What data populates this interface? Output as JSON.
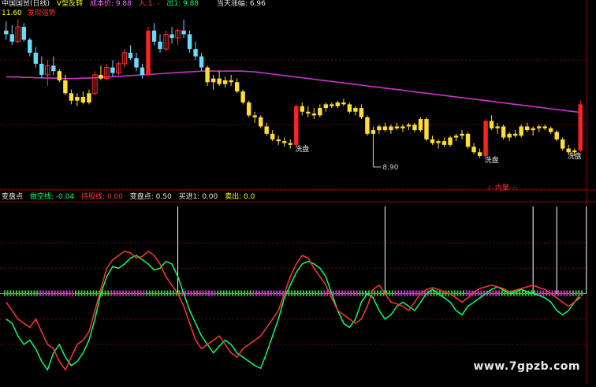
{
  "header": {
    "title": "中国国贸(日线)",
    "indicator": "V型反转",
    "cost_label": "成本价: 9.88",
    "in_label": "入:1. -",
    "out_label": "出1: 9.88",
    "today_label": "当天涨幅: 6.96",
    "price_tag": "11.60",
    "signal_tag": "发现强势"
  },
  "lower_header": {
    "items": [
      {
        "text": "变盘点",
        "color": "#e6e6e6"
      },
      {
        "text": "做空线: -0.04",
        "color": "#00ff66"
      },
      {
        "text": "持股线: 0.00",
        "color": "#ff3333"
      },
      {
        "text": "变盘点: 0.50",
        "color": "#e6e6e6"
      },
      {
        "text": "买进1: 0.00",
        "color": "#e6e6e6"
      },
      {
        "text": "卖出: 0.0",
        "color": "#ffff00"
      }
    ]
  },
  "watermark": "www.7gpzb.com",
  "chart_data": [
    {
      "type": "candlestick",
      "name": "price",
      "ohlc": [
        [
          11.3,
          11.55,
          11.05,
          11.2
        ],
        [
          11.2,
          11.45,
          10.9,
          11.0
        ],
        [
          11.0,
          11.6,
          10.95,
          11.4
        ],
        [
          11.4,
          11.5,
          11.0,
          11.05
        ],
        [
          11.05,
          11.1,
          10.6,
          10.7
        ],
        [
          10.7,
          10.85,
          10.3,
          10.4
        ],
        [
          10.4,
          10.6,
          10.0,
          10.1
        ],
        [
          10.1,
          10.5,
          9.8,
          10.35
        ],
        [
          10.35,
          10.6,
          10.1,
          10.2
        ],
        [
          10.2,
          10.25,
          9.9,
          9.95
        ],
        [
          9.95,
          10.1,
          9.55,
          9.6
        ],
        [
          9.6,
          9.7,
          9.3,
          9.4
        ],
        [
          9.4,
          9.6,
          9.25,
          9.5
        ],
        [
          9.5,
          9.65,
          9.3,
          9.35
        ],
        [
          9.35,
          9.7,
          9.3,
          9.6
        ],
        [
          9.6,
          10.2,
          9.55,
          10.1
        ],
        [
          10.1,
          10.35,
          9.95,
          10.0
        ],
        [
          10.0,
          10.4,
          9.95,
          10.3
        ],
        [
          10.3,
          10.5,
          10.05,
          10.15
        ],
        [
          10.15,
          10.45,
          10.1,
          10.4
        ],
        [
          10.4,
          10.8,
          10.3,
          10.7
        ],
        [
          10.7,
          10.9,
          10.5,
          10.55
        ],
        [
          10.55,
          10.7,
          10.2,
          10.3
        ],
        [
          10.3,
          10.4,
          10.0,
          10.1
        ],
        [
          10.1,
          11.4,
          10.05,
          11.3
        ],
        [
          11.3,
          11.5,
          10.9,
          11.0
        ],
        [
          11.0,
          11.2,
          10.7,
          10.8
        ],
        [
          10.8,
          11.3,
          10.75,
          11.2
        ],
        [
          11.2,
          11.4,
          10.95,
          11.1
        ],
        [
          11.1,
          11.35,
          10.9,
          11.3
        ],
        [
          11.3,
          11.6,
          11.1,
          11.2
        ],
        [
          11.2,
          11.3,
          10.7,
          10.8
        ],
        [
          10.8,
          11.0,
          10.5,
          10.6
        ],
        [
          10.6,
          10.7,
          10.2,
          10.3
        ],
        [
          10.3,
          10.35,
          9.8,
          9.9
        ],
        [
          9.9,
          10.1,
          9.7,
          10.0
        ],
        [
          10.0,
          10.2,
          9.8,
          9.85
        ],
        [
          9.85,
          10.05,
          9.75,
          9.95
        ],
        [
          9.95,
          10.1,
          9.8,
          9.9
        ],
        [
          9.9,
          10.0,
          9.6,
          9.65
        ],
        [
          9.65,
          9.7,
          9.3,
          9.35
        ],
        [
          9.35,
          9.4,
          8.95,
          9.0
        ],
        [
          9.0,
          9.1,
          8.8,
          8.95
        ],
        [
          8.95,
          9.0,
          8.65,
          8.7
        ],
        [
          8.7,
          8.8,
          8.45,
          8.5
        ],
        [
          8.5,
          8.6,
          8.3,
          8.35
        ],
        [
          8.35,
          8.45,
          8.2,
          8.3
        ],
        [
          8.3,
          8.4,
          8.15,
          8.25
        ],
        [
          8.25,
          8.35,
          8.1,
          8.2
        ],
        [
          8.2,
          9.3,
          8.15,
          9.25
        ],
        [
          9.25,
          9.35,
          9.0,
          9.1
        ],
        [
          9.1,
          9.25,
          8.95,
          9.05
        ],
        [
          9.05,
          9.2,
          8.9,
          9.0
        ],
        [
          9.0,
          9.3,
          8.95,
          9.2
        ],
        [
          9.2,
          9.35,
          9.1,
          9.3
        ],
        [
          9.3,
          9.35,
          9.2,
          9.25
        ],
        [
          9.25,
          9.4,
          9.2,
          9.35
        ],
        [
          9.35,
          9.45,
          9.25,
          9.3
        ],
        [
          9.3,
          9.35,
          9.05,
          9.1
        ],
        [
          9.1,
          9.25,
          9.0,
          9.2
        ],
        [
          9.2,
          9.3,
          8.9,
          8.95
        ],
        [
          8.95,
          9.0,
          8.45,
          8.5
        ],
        [
          8.5,
          8.7,
          7.6,
          8.6
        ],
        [
          8.6,
          8.75,
          8.5,
          8.7
        ],
        [
          8.7,
          8.8,
          8.55,
          8.6
        ],
        [
          8.6,
          8.75,
          8.5,
          8.7
        ],
        [
          8.7,
          8.8,
          8.6,
          8.65
        ],
        [
          8.65,
          8.75,
          8.55,
          8.7
        ],
        [
          8.7,
          8.8,
          8.6,
          8.75
        ],
        [
          8.75,
          8.8,
          8.55,
          8.6
        ],
        [
          8.6,
          8.95,
          8.55,
          8.9
        ],
        [
          8.9,
          8.95,
          8.3,
          8.35
        ],
        [
          8.35,
          8.45,
          8.2,
          8.25
        ],
        [
          8.25,
          8.35,
          8.1,
          8.3
        ],
        [
          8.3,
          8.4,
          8.15,
          8.2
        ],
        [
          8.2,
          8.45,
          8.15,
          8.4
        ],
        [
          8.4,
          8.5,
          8.3,
          8.45
        ],
        [
          8.45,
          8.6,
          8.35,
          8.5
        ],
        [
          8.5,
          8.55,
          8.1,
          8.15
        ],
        [
          8.15,
          8.25,
          7.95,
          8.0
        ],
        [
          8.0,
          8.1,
          7.85,
          7.9
        ],
        [
          7.9,
          8.9,
          7.85,
          8.85
        ],
        [
          8.85,
          9.0,
          8.6,
          8.65
        ],
        [
          8.65,
          8.8,
          8.5,
          8.7
        ],
        [
          8.7,
          8.75,
          8.35,
          8.4
        ],
        [
          8.4,
          8.55,
          8.3,
          8.5
        ],
        [
          8.5,
          8.6,
          8.4,
          8.45
        ],
        [
          8.45,
          8.75,
          8.4,
          8.7
        ],
        [
          8.7,
          8.8,
          8.55,
          8.6
        ],
        [
          8.6,
          8.7,
          8.45,
          8.65
        ],
        [
          8.65,
          8.75,
          8.55,
          8.7
        ],
        [
          8.7,
          8.75,
          8.6,
          8.65
        ],
        [
          8.65,
          8.7,
          8.5,
          8.55
        ],
        [
          8.55,
          8.6,
          8.3,
          8.35
        ],
        [
          8.35,
          8.4,
          8.05,
          8.1
        ],
        [
          8.1,
          8.2,
          7.95,
          8.0
        ],
        [
          8.0,
          8.1,
          7.9,
          8.05
        ],
        [
          8.05,
          9.4,
          8.0,
          9.3
        ]
      ],
      "ma": [
        10.05,
        10.04,
        10.04,
        10.03,
        10.03,
        10.02,
        10.02,
        10.01,
        10.01,
        10.0,
        10.0,
        10.0,
        10.0,
        10.01,
        10.01,
        10.02,
        10.03,
        10.04,
        10.05,
        10.06,
        10.07,
        10.08,
        10.09,
        10.1,
        10.11,
        10.12,
        10.13,
        10.14,
        10.15,
        10.16,
        10.17,
        10.18,
        10.19,
        10.2,
        10.2,
        10.2,
        10.2,
        10.2,
        10.2,
        10.2,
        10.2,
        10.19,
        10.18,
        10.16,
        10.14,
        10.12,
        10.1,
        10.08,
        10.06,
        10.04,
        10.02,
        10.0,
        9.98,
        9.96,
        9.94,
        9.92,
        9.9,
        9.88,
        9.86,
        9.84,
        9.82,
        9.8,
        9.78,
        9.76,
        9.74,
        9.72,
        9.7,
        9.68,
        9.66,
        9.64,
        9.62,
        9.6,
        9.58,
        9.56,
        9.54,
        9.52,
        9.5,
        9.48,
        9.46,
        9.44,
        9.42,
        9.4,
        9.38,
        9.36,
        9.34,
        9.32,
        9.3,
        9.28,
        9.26,
        9.24,
        9.22,
        9.2,
        9.18,
        9.16,
        9.14,
        9.12,
        9.1,
        9.08
      ],
      "price_labels": [
        {
          "text": "8.90",
          "value": 7.6,
          "index": 62
        }
      ],
      "annotations": [
        {
          "text": "洗盘",
          "index": 48,
          "value": 8.2
        },
        {
          "text": "洗盘",
          "index": 80,
          "value": 7.9
        },
        {
          "text": "洗盘",
          "index": 94,
          "value": 8.0
        },
        {
          "text": "☆-内聚-☆",
          "index": 84,
          "value": 7.15
        }
      ],
      "reference_levels": [
        7.0,
        8.75,
        10.5
      ]
    },
    {
      "type": "line",
      "name": "oscillator",
      "ylim": [
        -1.0,
        1.0
      ],
      "series": [
        {
          "name": "做空线",
          "color": "#00ff66",
          "values": [
            -0.3,
            -0.35,
            -0.5,
            -0.6,
            -0.55,
            -0.65,
            -0.8,
            -0.9,
            -0.7,
            -0.6,
            -0.75,
            -0.85,
            -0.8,
            -0.7,
            -0.55,
            -0.3,
            0.0,
            0.2,
            0.32,
            0.3,
            0.35,
            0.42,
            0.45,
            0.4,
            0.35,
            0.28,
            0.3,
            0.38,
            0.35,
            0.2,
            0.0,
            -0.2,
            -0.35,
            -0.5,
            -0.6,
            -0.7,
            -0.62,
            -0.55,
            -0.6,
            -0.7,
            -0.75,
            -0.8,
            -0.85,
            -0.88,
            -0.7,
            -0.5,
            -0.3,
            -0.05,
            0.1,
            0.25,
            0.35,
            0.38,
            0.35,
            0.3,
            0.2,
            0.0,
            -0.2,
            -0.35,
            -0.4,
            -0.3,
            -0.1,
            0.0,
            -0.05,
            -0.2,
            -0.3,
            -0.25,
            -0.15,
            -0.1,
            -0.15,
            -0.2,
            -0.1,
            0.0,
            0.05,
            0.0,
            -0.05,
            -0.1,
            -0.2,
            -0.25,
            -0.15,
            -0.1,
            -0.05,
            0.0,
            0.05,
            0.08,
            0.04,
            0.0,
            0.02,
            0.05,
            0.02,
            0.0,
            -0.02,
            -0.05,
            -0.1,
            -0.2,
            -0.25,
            -0.2,
            -0.1,
            -0.04
          ]
        },
        {
          "name": "持股线",
          "color": "#ff3333",
          "values": [
            -0.1,
            -0.2,
            -0.3,
            -0.35,
            -0.4,
            -0.3,
            -0.45,
            -0.6,
            -0.65,
            -0.8,
            -0.9,
            -0.75,
            -0.6,
            -0.55,
            -0.45,
            -0.2,
            0.05,
            0.3,
            0.4,
            0.45,
            0.5,
            0.48,
            0.42,
            0.44,
            0.5,
            0.45,
            0.35,
            0.2,
            0.1,
            0.0,
            -0.15,
            -0.35,
            -0.55,
            -0.65,
            -0.6,
            -0.55,
            -0.5,
            -0.6,
            -0.7,
            -0.75,
            -0.65,
            -0.6,
            -0.55,
            -0.5,
            -0.4,
            -0.3,
            -0.2,
            0.0,
            0.2,
            0.35,
            0.45,
            0.42,
            0.3,
            0.2,
            0.1,
            -0.05,
            -0.2,
            -0.25,
            -0.3,
            -0.35,
            -0.3,
            -0.15,
            0.05,
            0.1,
            0.0,
            -0.1,
            -0.12,
            -0.15,
            -0.2,
            -0.1,
            0.0,
            0.05,
            0.07,
            0.05,
            0.02,
            0.0,
            -0.05,
            -0.1,
            -0.05,
            0.02,
            0.06,
            0.08,
            0.1,
            0.08,
            0.06,
            0.02,
            0.04,
            0.06,
            0.08,
            0.1,
            0.07,
            0.05,
            0.0,
            -0.05,
            -0.1,
            -0.15,
            -0.1,
            0.0
          ]
        }
      ],
      "buy_spikes": [
        29,
        64,
        89,
        93,
        98
      ],
      "zero_line": 0
    }
  ]
}
